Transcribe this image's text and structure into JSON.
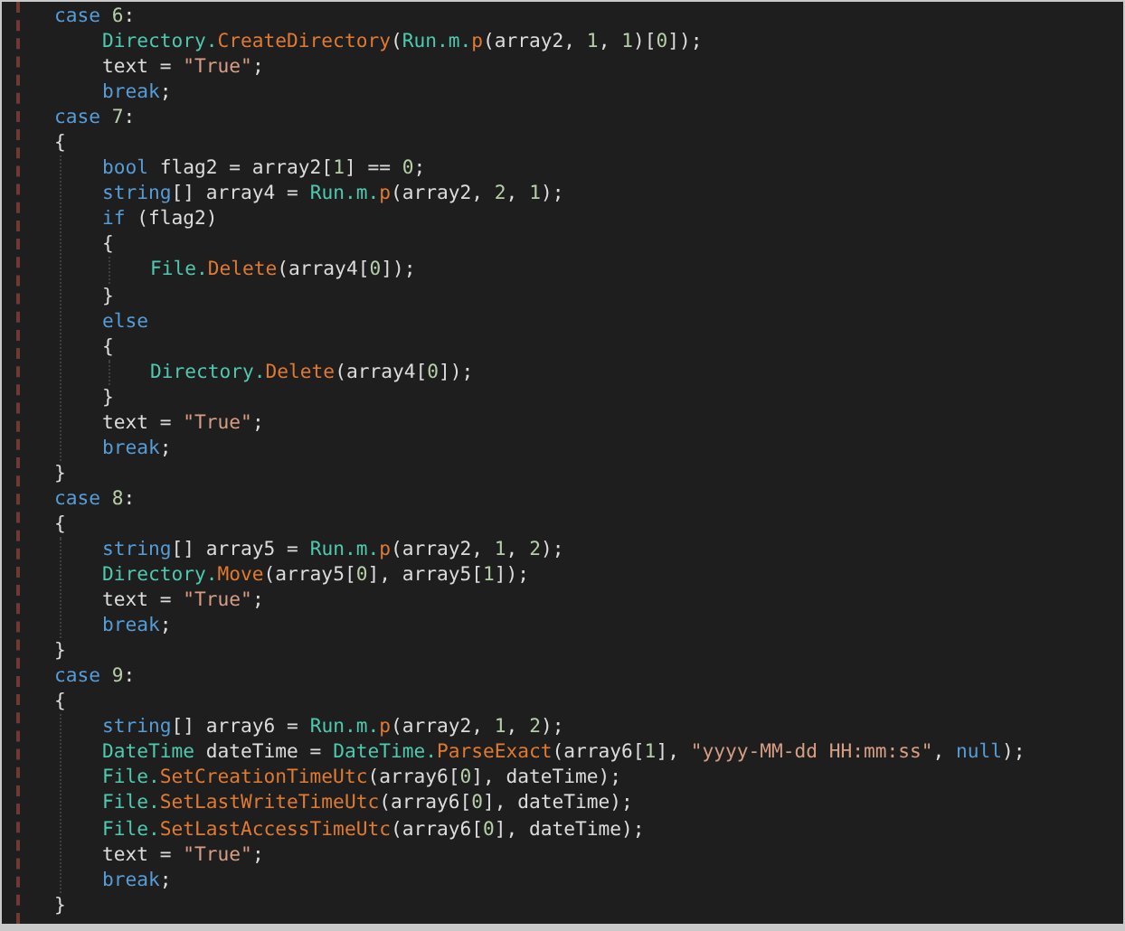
{
  "code": [
    {
      "tokens": [
        {
          "kind": "keyword",
          "text": "case "
        },
        {
          "kind": "number",
          "text": "6"
        },
        {
          "kind": "plain",
          "text": ":"
        }
      ],
      "children": [
        {
          "tokens": [
            {
              "kind": "type",
              "text": "Directory."
            },
            {
              "kind": "method",
              "text": "CreateDirectory"
            },
            {
              "kind": "plain",
              "text": "("
            },
            {
              "kind": "type",
              "text": "Run.m."
            },
            {
              "kind": "method",
              "text": "p"
            },
            {
              "kind": "plain",
              "text": "(array2, "
            },
            {
              "kind": "number",
              "text": "1"
            },
            {
              "kind": "plain",
              "text": ", "
            },
            {
              "kind": "number",
              "text": "1"
            },
            {
              "kind": "plain",
              "text": ")["
            },
            {
              "kind": "number",
              "text": "0"
            },
            {
              "kind": "plain",
              "text": "]);"
            }
          ]
        },
        {
          "tokens": [
            {
              "kind": "plain",
              "text": "text = "
            },
            {
              "kind": "string",
              "text": "\"True\""
            },
            {
              "kind": "plain",
              "text": ";"
            }
          ]
        },
        {
          "tokens": [
            {
              "kind": "keyword",
              "text": "break"
            },
            {
              "kind": "plain",
              "text": ";"
            }
          ]
        }
      ]
    },
    {
      "tokens": [
        {
          "kind": "keyword",
          "text": "case "
        },
        {
          "kind": "number",
          "text": "7"
        },
        {
          "kind": "plain",
          "text": ":"
        }
      ]
    },
    {
      "tokens": [
        {
          "kind": "plain",
          "text": "{"
        }
      ],
      "children": [
        {
          "tokens": [
            {
              "kind": "keyword",
              "text": "bool"
            },
            {
              "kind": "plain",
              "text": " flag2 = array2["
            },
            {
              "kind": "number",
              "text": "1"
            },
            {
              "kind": "plain",
              "text": "] == "
            },
            {
              "kind": "number",
              "text": "0"
            },
            {
              "kind": "plain",
              "text": ";"
            }
          ]
        },
        {
          "tokens": [
            {
              "kind": "keyword",
              "text": "string"
            },
            {
              "kind": "plain",
              "text": "[] array4 = "
            },
            {
              "kind": "type",
              "text": "Run.m."
            },
            {
              "kind": "method",
              "text": "p"
            },
            {
              "kind": "plain",
              "text": "(array2, "
            },
            {
              "kind": "number",
              "text": "2"
            },
            {
              "kind": "plain",
              "text": ", "
            },
            {
              "kind": "number",
              "text": "1"
            },
            {
              "kind": "plain",
              "text": ");"
            }
          ]
        },
        {
          "tokens": [
            {
              "kind": "keyword",
              "text": "if"
            },
            {
              "kind": "plain",
              "text": " (flag2)"
            }
          ]
        },
        {
          "tokens": [
            {
              "kind": "plain",
              "text": "{"
            }
          ],
          "children": [
            {
              "tokens": [
                {
                  "kind": "type",
                  "text": "File."
                },
                {
                  "kind": "method",
                  "text": "Delete"
                },
                {
                  "kind": "plain",
                  "text": "(array4["
                },
                {
                  "kind": "number",
                  "text": "0"
                },
                {
                  "kind": "plain",
                  "text": "]);"
                }
              ]
            }
          ]
        },
        {
          "tokens": [
            {
              "kind": "plain",
              "text": "}"
            }
          ]
        },
        {
          "tokens": [
            {
              "kind": "keyword",
              "text": "else"
            }
          ]
        },
        {
          "tokens": [
            {
              "kind": "plain",
              "text": "{"
            }
          ],
          "children": [
            {
              "tokens": [
                {
                  "kind": "type",
                  "text": "Directory."
                },
                {
                  "kind": "method",
                  "text": "Delete"
                },
                {
                  "kind": "plain",
                  "text": "(array4["
                },
                {
                  "kind": "number",
                  "text": "0"
                },
                {
                  "kind": "plain",
                  "text": "]);"
                }
              ]
            }
          ]
        },
        {
          "tokens": [
            {
              "kind": "plain",
              "text": "}"
            }
          ]
        },
        {
          "tokens": [
            {
              "kind": "plain",
              "text": "text = "
            },
            {
              "kind": "string",
              "text": "\"True\""
            },
            {
              "kind": "plain",
              "text": ";"
            }
          ]
        },
        {
          "tokens": [
            {
              "kind": "keyword",
              "text": "break"
            },
            {
              "kind": "plain",
              "text": ";"
            }
          ]
        }
      ]
    },
    {
      "tokens": [
        {
          "kind": "plain",
          "text": "}"
        }
      ]
    },
    {
      "tokens": [
        {
          "kind": "keyword",
          "text": "case "
        },
        {
          "kind": "number",
          "text": "8"
        },
        {
          "kind": "plain",
          "text": ":"
        }
      ]
    },
    {
      "tokens": [
        {
          "kind": "plain",
          "text": "{"
        }
      ],
      "children": [
        {
          "tokens": [
            {
              "kind": "keyword",
              "text": "string"
            },
            {
              "kind": "plain",
              "text": "[] array5 = "
            },
            {
              "kind": "type",
              "text": "Run.m."
            },
            {
              "kind": "method",
              "text": "p"
            },
            {
              "kind": "plain",
              "text": "(array2, "
            },
            {
              "kind": "number",
              "text": "1"
            },
            {
              "kind": "plain",
              "text": ", "
            },
            {
              "kind": "number",
              "text": "2"
            },
            {
              "kind": "plain",
              "text": ");"
            }
          ]
        },
        {
          "tokens": [
            {
              "kind": "type",
              "text": "Directory."
            },
            {
              "kind": "method",
              "text": "Move"
            },
            {
              "kind": "plain",
              "text": "(array5["
            },
            {
              "kind": "number",
              "text": "0"
            },
            {
              "kind": "plain",
              "text": "], array5["
            },
            {
              "kind": "number",
              "text": "1"
            },
            {
              "kind": "plain",
              "text": "]);"
            }
          ]
        },
        {
          "tokens": [
            {
              "kind": "plain",
              "text": "text = "
            },
            {
              "kind": "string",
              "text": "\"True\""
            },
            {
              "kind": "plain",
              "text": ";"
            }
          ]
        },
        {
          "tokens": [
            {
              "kind": "keyword",
              "text": "break"
            },
            {
              "kind": "plain",
              "text": ";"
            }
          ]
        }
      ]
    },
    {
      "tokens": [
        {
          "kind": "plain",
          "text": "}"
        }
      ]
    },
    {
      "tokens": [
        {
          "kind": "keyword",
          "text": "case "
        },
        {
          "kind": "number",
          "text": "9"
        },
        {
          "kind": "plain",
          "text": ":"
        }
      ]
    },
    {
      "tokens": [
        {
          "kind": "plain",
          "text": "{"
        }
      ],
      "children": [
        {
          "tokens": [
            {
              "kind": "keyword",
              "text": "string"
            },
            {
              "kind": "plain",
              "text": "[] array6 = "
            },
            {
              "kind": "type",
              "text": "Run.m."
            },
            {
              "kind": "method",
              "text": "p"
            },
            {
              "kind": "plain",
              "text": "(array2, "
            },
            {
              "kind": "number",
              "text": "1"
            },
            {
              "kind": "plain",
              "text": ", "
            },
            {
              "kind": "number",
              "text": "2"
            },
            {
              "kind": "plain",
              "text": ");"
            }
          ]
        },
        {
          "tokens": [
            {
              "kind": "type",
              "text": "DateTime"
            },
            {
              "kind": "plain",
              "text": " dateTime = "
            },
            {
              "kind": "type",
              "text": "DateTime."
            },
            {
              "kind": "method",
              "text": "ParseExact"
            },
            {
              "kind": "plain",
              "text": "(array6["
            },
            {
              "kind": "number",
              "text": "1"
            },
            {
              "kind": "plain",
              "text": "], "
            },
            {
              "kind": "string",
              "text": "\"yyyy-MM-dd HH:mm:ss\""
            },
            {
              "kind": "plain",
              "text": ", "
            },
            {
              "kind": "keyword",
              "text": "null"
            },
            {
              "kind": "plain",
              "text": ");"
            }
          ]
        },
        {
          "tokens": [
            {
              "kind": "type",
              "text": "File."
            },
            {
              "kind": "method",
              "text": "SetCreationTimeUtc"
            },
            {
              "kind": "plain",
              "text": "(array6["
            },
            {
              "kind": "number",
              "text": "0"
            },
            {
              "kind": "plain",
              "text": "], dateTime);"
            }
          ]
        },
        {
          "tokens": [
            {
              "kind": "type",
              "text": "File."
            },
            {
              "kind": "method",
              "text": "SetLastWriteTimeUtc"
            },
            {
              "kind": "plain",
              "text": "(array6["
            },
            {
              "kind": "number",
              "text": "0"
            },
            {
              "kind": "plain",
              "text": "], dateTime);"
            }
          ]
        },
        {
          "tokens": [
            {
              "kind": "type",
              "text": "File."
            },
            {
              "kind": "method",
              "text": "SetLastAccessTimeUtc"
            },
            {
              "kind": "plain",
              "text": "(array6["
            },
            {
              "kind": "number",
              "text": "0"
            },
            {
              "kind": "plain",
              "text": "], dateTime);"
            }
          ]
        },
        {
          "tokens": [
            {
              "kind": "plain",
              "text": "text = "
            },
            {
              "kind": "string",
              "text": "\"True\""
            },
            {
              "kind": "plain",
              "text": ";"
            }
          ]
        },
        {
          "tokens": [
            {
              "kind": "keyword",
              "text": "break"
            },
            {
              "kind": "plain",
              "text": ";"
            }
          ]
        }
      ]
    },
    {
      "tokens": [
        {
          "kind": "plain",
          "text": "}"
        }
      ]
    }
  ]
}
